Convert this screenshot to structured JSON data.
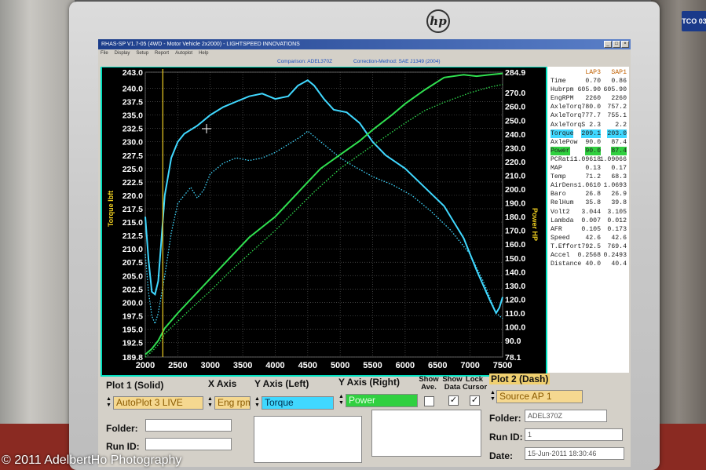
{
  "window": {
    "title": "RHAS-SP V1.7-05   (4WD - Motor Vehicle 2x2000) - LIGHTSPEED INNOVATIONS",
    "menu": [
      "File",
      "Display",
      "Setup",
      "Report",
      "Autoplot",
      "Help"
    ],
    "comparison": "Comparison: ADEL370Z",
    "correction": "Correction-Method: SAE J1349 (2004)"
  },
  "colors": {
    "torque_solid": "#40d8ff",
    "power_solid": "#30e050",
    "cursor_line": "#e0c020"
  },
  "chart_data": {
    "type": "line",
    "xlabel": "",
    "ylabel_left": "Torque lbft",
    "ylabel_right": "Power HP",
    "xlim": [
      2000,
      7500
    ],
    "ylim_left": [
      189.8,
      243.0
    ],
    "ylim_right": [
      78.1,
      284.9
    ],
    "x_ticks": [
      2000,
      2500,
      3000,
      3500,
      4000,
      4500,
      5000,
      5500,
      6000,
      6500,
      7000,
      7500
    ],
    "y_left_ticks": [
      "243.0",
      "240.0",
      "237.5",
      "235.0",
      "232.5",
      "230.0",
      "227.5",
      "225.0",
      "222.5",
      "220.0",
      "217.5",
      "215.0",
      "212.5",
      "210.0",
      "207.5",
      "205.0",
      "202.5",
      "200.0",
      "197.5",
      "195.0",
      "192.5",
      "189.8"
    ],
    "y_left_values": [
      243.0,
      240.0,
      237.5,
      235.0,
      232.5,
      230.0,
      227.5,
      225.0,
      222.5,
      220.0,
      217.5,
      215.0,
      212.5,
      210.0,
      207.5,
      205.0,
      202.5,
      200.0,
      197.5,
      195.0,
      192.5,
      189.8
    ],
    "y_right_ticks": [
      "284.9",
      "270.0",
      "260.0",
      "250.0",
      "240.0",
      "230.0",
      "220.0",
      "210.0",
      "200.0",
      "190.0",
      "180.0",
      "170.0",
      "160.0",
      "150.0",
      "140.0",
      "130.0",
      "120.0",
      "110.0",
      "100.0",
      "90.0",
      "78.1"
    ],
    "y_right_values": [
      284.9,
      270,
      260,
      250,
      240,
      230,
      220,
      210,
      200,
      190,
      180,
      170,
      160,
      150,
      140,
      130,
      120,
      110,
      100,
      90,
      78.1
    ],
    "grid": true,
    "cursor_x": 2270,
    "series": [
      {
        "axis": "left",
        "style": "solid",
        "color": "#40d8ff",
        "x": [
          2000,
          2050,
          2100,
          2150,
          2200,
          2250,
          2300,
          2400,
          2500,
          2600,
          2800,
          3000,
          3200,
          3400,
          3600,
          3800,
          4000,
          4200,
          4350,
          4500,
          4600,
          4750,
          4900,
          5100,
          5300,
          5500,
          5700,
          6000,
          6300,
          6600,
          6900,
          7100,
          7300,
          7400,
          7450,
          7500
        ],
        "y": [
          216.0,
          208.0,
          202.0,
          201.5,
          204.0,
          212.0,
          220.0,
          227.0,
          230.0,
          231.5,
          233.0,
          235.0,
          236.5,
          237.5,
          238.5,
          239.0,
          238.0,
          238.5,
          240.5,
          241.5,
          240.5,
          238.0,
          236.0,
          235.5,
          233.5,
          230.0,
          227.5,
          225.0,
          221.5,
          218.0,
          212.0,
          206.0,
          200.5,
          198.0,
          199.0,
          201.0
        ]
      },
      {
        "axis": "left",
        "style": "dotted",
        "color": "#40d8ff",
        "x": [
          2000,
          2050,
          2100,
          2150,
          2200,
          2300,
          2400,
          2500,
          2600,
          2700,
          2800,
          2900,
          3000,
          3200,
          3400,
          3600,
          3800,
          4000,
          4200,
          4400,
          4500,
          4600,
          4800,
          5000,
          5200,
          5500,
          5800,
          6100,
          6400,
          6700,
          7000,
          7200,
          7400,
          7500
        ],
        "y": [
          209.0,
          202.0,
          197.5,
          196.0,
          198.0,
          205.0,
          213.0,
          218.5,
          220.0,
          221.5,
          219.5,
          221.0,
          224.0,
          226.0,
          227.0,
          226.5,
          227.0,
          228.0,
          229.5,
          231.0,
          232.0,
          231.0,
          229.0,
          227.0,
          225.5,
          223.5,
          222.0,
          220.0,
          217.0,
          213.5,
          209.0,
          204.0,
          198.0,
          197.0
        ]
      },
      {
        "axis": "right",
        "style": "solid",
        "color": "#30e050",
        "x": [
          2000,
          2100,
          2200,
          2300,
          2500,
          2700,
          3000,
          3300,
          3600,
          4000,
          4300,
          4500,
          4700,
          5000,
          5300,
          5500,
          5800,
          6000,
          6300,
          6600,
          6900,
          7100,
          7300,
          7500
        ],
        "y": [
          80,
          84,
          90,
          99,
          110,
          120,
          135,
          150,
          165,
          180,
          195,
          205,
          215,
          225,
          235,
          243,
          254,
          262,
          272,
          281,
          283,
          282,
          283,
          284
        ]
      },
      {
        "axis": "right",
        "style": "dotted",
        "color": "#30e050",
        "x": [
          2000,
          2100,
          2200,
          2300,
          2500,
          2700,
          3000,
          3300,
          3600,
          4000,
          4300,
          4600,
          5000,
          5300,
          5600,
          6000,
          6300,
          6600,
          7000,
          7300,
          7500
        ],
        "y": [
          78,
          82,
          87,
          95,
          104,
          113,
          126,
          140,
          153,
          170,
          184,
          198,
          215,
          225,
          235,
          248,
          257,
          263,
          270,
          274,
          276
        ]
      }
    ]
  },
  "data_panel": {
    "headers": [
      "LAP3",
      "SAP1"
    ],
    "rows": [
      {
        "label": "Time",
        "v1": "0.70",
        "v2": "0.86",
        "hl": ""
      },
      {
        "label": "Hubrpm",
        "v1": "605.90",
        "v2": "605.90",
        "hl": ""
      },
      {
        "label": "EngRPM",
        "v1": "2260",
        "v2": "2260",
        "hl": ""
      },
      {
        "label": "AxleTorq",
        "v1": "780.0",
        "v2": "757.2",
        "hl": ""
      },
      {
        "label": "AxleTorq",
        "v1": "777.7",
        "v2": "755.1",
        "hl": ""
      },
      {
        "label": "AxleTorqS",
        "v1": "2.3",
        "v2": "2.2",
        "hl": ""
      },
      {
        "label": "Torque",
        "v1": "209.1",
        "v2": "203.0",
        "hl": "cyan"
      },
      {
        "label": "AxlePow",
        "v1": "90.0",
        "v2": "87.4",
        "hl": ""
      },
      {
        "label": "Power",
        "v1": "90.0",
        "v2": "87.4",
        "hl": "green"
      },
      {
        "label": "PCRati1",
        "v1": "1.09618",
        "v2": "1.09066",
        "hl": ""
      },
      {
        "label": "MAP",
        "v1": "0.13",
        "v2": "0.17",
        "hl": ""
      },
      {
        "label": "Temp",
        "v1": "71.2",
        "v2": "68.3",
        "hl": ""
      },
      {
        "label": "AirDens",
        "v1": "1.0610",
        "v2": "1.0693",
        "hl": ""
      },
      {
        "label": "Baro",
        "v1": "26.8",
        "v2": "26.9",
        "hl": ""
      },
      {
        "label": "RelHum",
        "v1": "35.8",
        "v2": "39.8",
        "hl": ""
      },
      {
        "label": "Volt2",
        "v1": "3.044",
        "v2": "3.105",
        "hl": ""
      },
      {
        "label": "Lambda",
        "v1": "0.007",
        "v2": "0.012",
        "hl": ""
      },
      {
        "label": "AFR",
        "v1": "0.105",
        "v2": "0.173",
        "hl": ""
      },
      {
        "label": "Speed",
        "v1": "42.6",
        "v2": "42.6",
        "hl": ""
      },
      {
        "label": "T.Effort",
        "v1": "792.5",
        "v2": "769.4",
        "hl": ""
      },
      {
        "label": "Accel",
        "v1": "0.2568",
        "v2": "0.2493",
        "hl": ""
      },
      {
        "label": "Distance",
        "v1": "40.0",
        "v2": "40.4",
        "hl": ""
      }
    ]
  },
  "controls": {
    "plot1_label": "Plot 1 (Solid)",
    "x_axis_label": "X Axis",
    "y_left_label": "Y Axis (Left)",
    "y_right_label": "Y Axis (Right)",
    "show_ave_label": "Show Ave.",
    "show_data_label": "Show Data",
    "lock_cursor_label": "Lock Cursor",
    "plot2_label": "Plot 2 (Dash)",
    "plot1_value": "AutoPlot 3 LIVE",
    "x_axis_value": "Eng rpm",
    "y_left_value": "Torque",
    "y_right_value": "Power",
    "plot2_value": "Source AP 1",
    "show_ave_checked": false,
    "show_data_checked": true,
    "lock_cursor_checked": true,
    "folder_label": "Folder:",
    "run_id_label": "Run ID:",
    "date_label": "Date:",
    "folder2_value": "ADEL370Z",
    "run_id2_value": "1",
    "date_value": "15-Jun-2011   18:30:46"
  },
  "device": {
    "brand": "hp",
    "badge": "TCO 03"
  },
  "watermark": "© 2011 AdelbertHo Photography"
}
